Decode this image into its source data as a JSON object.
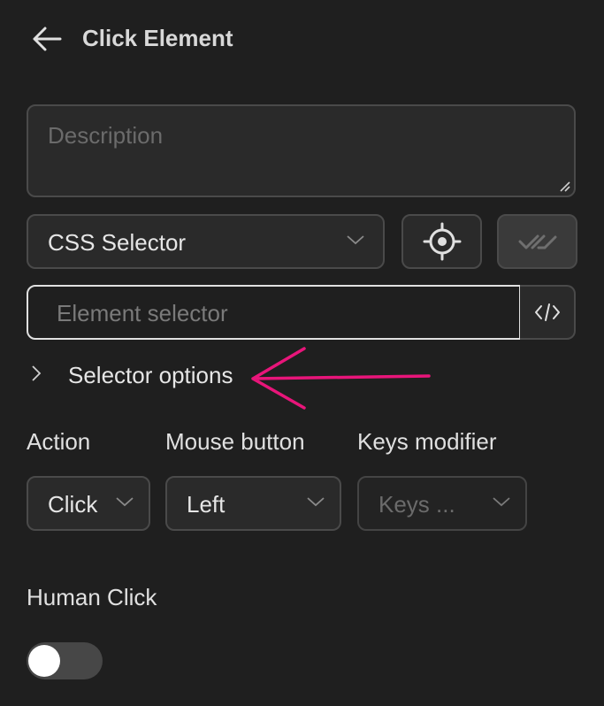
{
  "header": {
    "title": "Click Element"
  },
  "description": {
    "placeholder": "Description"
  },
  "selector_type": {
    "value": "CSS Selector"
  },
  "selector_input": {
    "placeholder": "Element selector"
  },
  "selector_options": {
    "label": "Selector options"
  },
  "fields": {
    "action": {
      "label": "Action",
      "value": "Click"
    },
    "mouse_button": {
      "label": "Mouse button",
      "value": "Left"
    },
    "keys_modifier": {
      "label": "Keys modifier",
      "placeholder": "Keys ..."
    }
  },
  "human_click": {
    "label": "Human Click",
    "enabled": false
  },
  "icons": {
    "back": "arrow-left-icon",
    "target": "crosshair-icon",
    "verify": "double-check-icon",
    "code": "code-icon",
    "expand": "chevron-right-icon",
    "dropdown": "chevron-down-icon"
  },
  "colors": {
    "background": "#1f1f1f",
    "annotation": "#e8157a"
  }
}
